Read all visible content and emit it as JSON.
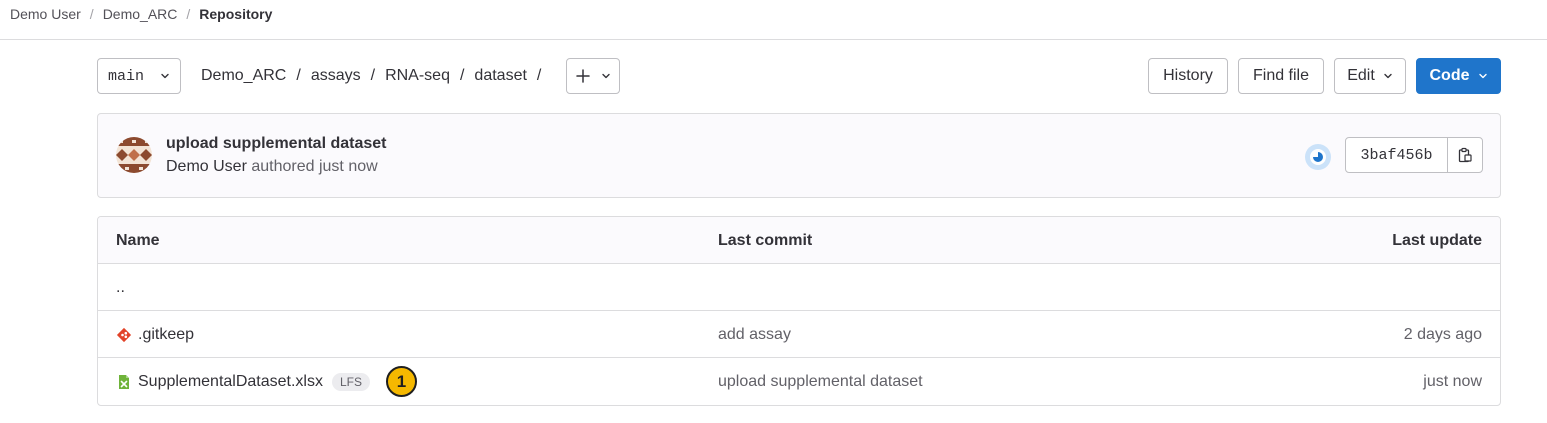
{
  "breadcrumb": [
    {
      "label": "Demo User"
    },
    {
      "label": "Demo_ARC"
    },
    {
      "label": "Repository"
    }
  ],
  "toolbar": {
    "branch": "main",
    "path": [
      "Demo_ARC",
      "assays",
      "RNA-seq",
      "dataset"
    ],
    "add_label": "+",
    "history_label": "History",
    "find_file_label": "Find file",
    "edit_label": "Edit",
    "code_label": "Code"
  },
  "last_commit": {
    "title": "upload supplemental dataset",
    "author": "Demo User",
    "authored_text": "authored just now",
    "sha": "3baf456b"
  },
  "file_table": {
    "headers": {
      "name": "Name",
      "last_commit": "Last commit",
      "last_update": "Last update"
    },
    "parent_dir": "..",
    "rows": [
      {
        "name": ".gitkeep",
        "icon": "git-file-icon",
        "last_commit": "add assay",
        "last_update": "2 days ago"
      },
      {
        "name": "SupplementalDataset.xlsx",
        "icon": "spreadsheet-file-icon",
        "badge": "LFS",
        "callout": "1",
        "last_commit": "upload supplemental dataset",
        "last_update": "just now"
      }
    ]
  },
  "colors": {
    "primary": "#1f75cb",
    "callout": "#f5b800",
    "git_icon": "#e24329",
    "xlsx_icon": "#6fb33a"
  }
}
